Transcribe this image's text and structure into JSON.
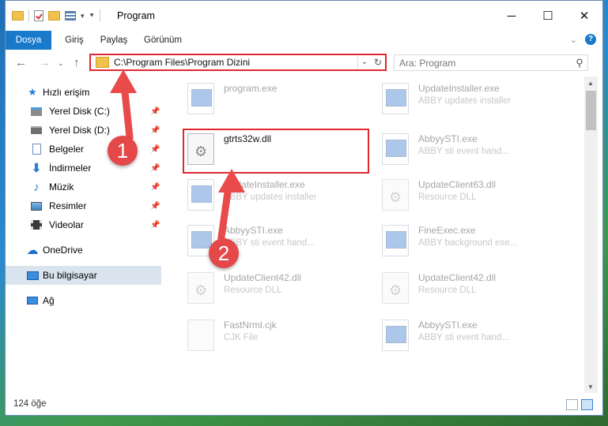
{
  "window": {
    "title": "Program",
    "controls": {
      "minimize": "─",
      "maximize": "☐",
      "close": "✕"
    }
  },
  "ribbon": {
    "tabs": [
      "Dosya",
      "Giriş",
      "Paylaş",
      "Görünüm"
    ]
  },
  "address": {
    "path": "C:\\Program Files\\Program Dizini"
  },
  "search": {
    "placeholder": "Ara: Program"
  },
  "sidebar": {
    "quick_access": "Hızlı erişim",
    "items": [
      {
        "label": "Yerel Disk (C:)",
        "icon": "drive-icon",
        "pinned": true
      },
      {
        "label": "Yerel Disk (D:)",
        "icon": "drive-icon",
        "pinned": true
      },
      {
        "label": "Belgeler",
        "icon": "documents-icon",
        "pinned": true
      },
      {
        "label": "İndirmeler",
        "icon": "download-icon",
        "pinned": true
      },
      {
        "label": "Müzik",
        "icon": "music-icon",
        "pinned": true
      },
      {
        "label": "Resimler",
        "icon": "pictures-icon",
        "pinned": true
      },
      {
        "label": "Videolar",
        "icon": "videos-icon",
        "pinned": true
      }
    ],
    "onedrive": "OneDrive",
    "this_pc": "Bu bilgisayar",
    "network": "Ağ"
  },
  "files": [
    {
      "name": "program.exe",
      "desc": "",
      "type": "exe",
      "dim": true
    },
    {
      "name": "UpdateInstaller.exe",
      "desc": "ABBY updates installer",
      "type": "exe",
      "dim": true
    },
    {
      "name": "gtrts32w.dll",
      "desc": "",
      "type": "dll",
      "dim": false
    },
    {
      "name": "AbbyySTI.exe",
      "desc": "ABBY sti event hand...",
      "type": "exe",
      "dim": true
    },
    {
      "name": "UpdateInstaller.exe",
      "desc": "ABBY updates installer",
      "type": "exe",
      "dim": true
    },
    {
      "name": "UpdateClient63.dll",
      "desc": "Resource DLL",
      "type": "dll",
      "dim": true
    },
    {
      "name": "AbbyySTI.exe",
      "desc": "ABBY sti event hand...",
      "type": "exe",
      "dim": true
    },
    {
      "name": "FineExec.exe",
      "desc": "ABBY background exe...",
      "type": "exe",
      "dim": true
    },
    {
      "name": "UpdateClient42.dll",
      "desc": "Resource DLL",
      "type": "dll",
      "dim": true
    },
    {
      "name": "UpdateClient42.dll",
      "desc": "Resource DLL",
      "type": "dll",
      "dim": true
    },
    {
      "name": "FastNrml.cjk",
      "desc": "CJK File",
      "type": "doc",
      "dim": true
    },
    {
      "name": "AbbyySTI.exe",
      "desc": "ABBY sti event hand...",
      "type": "exe",
      "dim": true
    }
  ],
  "status": {
    "count": "124 öğe"
  },
  "annotations": [
    "1",
    "2"
  ],
  "colors": {
    "accent": "#1979ca",
    "highlight": "#e0292f",
    "annotation": "#e44848"
  }
}
